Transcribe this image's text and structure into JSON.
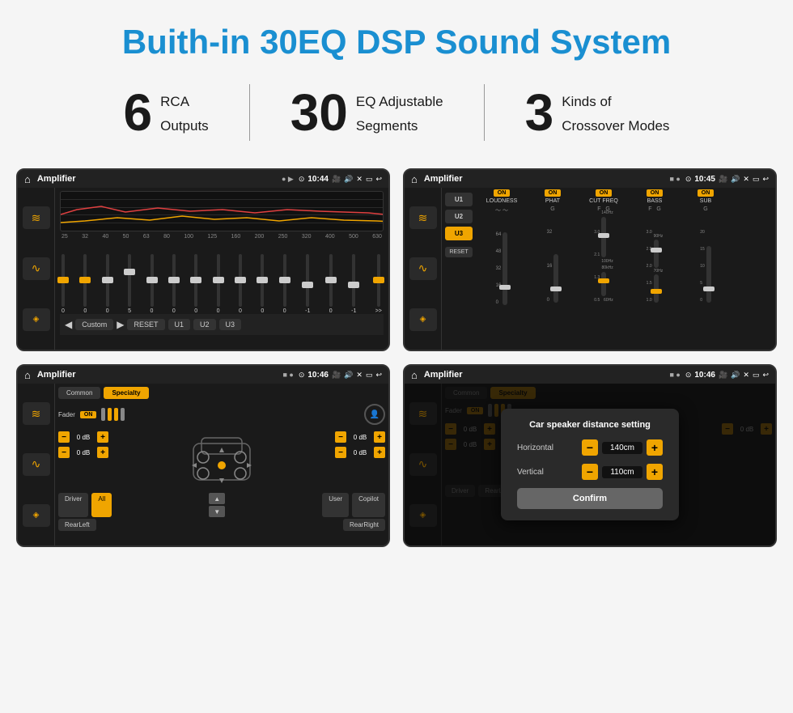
{
  "page": {
    "title": "Buith-in 30EQ DSP Sound System"
  },
  "stats": [
    {
      "number": "6",
      "text1": "RCA",
      "text2": "Outputs"
    },
    {
      "number": "30",
      "text1": "EQ Adjustable",
      "text2": "Segments"
    },
    {
      "number": "3",
      "text1": "Kinds of",
      "text2": "Crossover Modes"
    }
  ],
  "screens": {
    "screen1": {
      "title": "Amplifier",
      "time": "10:44",
      "eq_label": "Custom",
      "freq_labels": [
        "25",
        "32",
        "40",
        "50",
        "63",
        "80",
        "100",
        "125",
        "160",
        "200",
        "250",
        "320",
        "400",
        "500",
        "630"
      ],
      "eq_values": [
        "0",
        "0",
        "0",
        "5",
        "0",
        "0",
        "0",
        "0",
        "0",
        "0",
        "0",
        "-1",
        "0",
        "-1",
        ""
      ],
      "buttons": [
        "RESET",
        "U1",
        "U2",
        "U3"
      ]
    },
    "screen2": {
      "title": "Amplifier",
      "time": "10:45",
      "presets": [
        "U1",
        "U2",
        "U3"
      ],
      "controls": [
        "LOUDNESS",
        "PHAT",
        "CUT FREQ",
        "BASS",
        "SUB"
      ],
      "reset": "RESET"
    },
    "screen3": {
      "title": "Amplifier",
      "time": "10:46",
      "tabs": [
        "Common",
        "Specialty"
      ],
      "fader_label": "Fader",
      "fader_on": "ON",
      "db_values": [
        "0 dB",
        "0 dB",
        "0 dB",
        "0 dB"
      ],
      "bottom_btns": [
        "Driver",
        "RearLeft",
        "All",
        "User",
        "Copilot",
        "RearRight"
      ]
    },
    "screen4": {
      "title": "Amplifier",
      "time": "10:46",
      "tabs": [
        "Common",
        "Specialty"
      ],
      "dialog": {
        "title": "Car speaker distance setting",
        "horizontal_label": "Horizontal",
        "horizontal_value": "140cm",
        "vertical_label": "Vertical",
        "vertical_value": "110cm",
        "confirm_label": "Confirm"
      },
      "db_values": [
        "0 dB",
        "0 dB"
      ],
      "bottom_btns": [
        "Driver",
        "RearLeft",
        "All",
        "User",
        "Copilot",
        "RearRight"
      ]
    }
  },
  "icons": {
    "home": "⌂",
    "back": "↩",
    "settings": "⚙",
    "eq": "≋",
    "wave": "∿",
    "speaker": "◈",
    "camera": "📷",
    "volume": "🔊",
    "close": "✕",
    "minus_box": "□",
    "arrow_left": "◀",
    "arrow_right": "▶",
    "chevron_up": "▲",
    "chevron_down": "▼",
    "person": "👤",
    "location": "⊙"
  }
}
